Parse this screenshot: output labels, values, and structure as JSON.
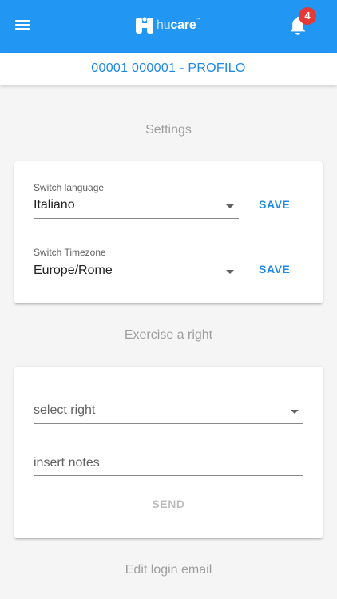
{
  "appbar": {
    "menu_icon": "hamburger-menu-icon",
    "logo": {
      "hu": "hu",
      "care": "care",
      "tm": "™"
    },
    "notifications": {
      "icon": "bell-icon",
      "count": "4"
    },
    "colors": {
      "primary": "#2196f3",
      "badge": "#e53935"
    }
  },
  "subheader": {
    "title": "00001 000001 - PROFILO"
  },
  "sections": {
    "settings": "Settings",
    "exercise": "Exercise a right",
    "login_email": "Edit login email"
  },
  "settings_card": {
    "language": {
      "label": "Switch language",
      "value": "Italiano",
      "save": "SAVE"
    },
    "timezone": {
      "label": "Switch Timezone",
      "value": "Europe/Rome",
      "save": "SAVE"
    }
  },
  "exercise_card": {
    "select_right": {
      "placeholder": "select right"
    },
    "notes": {
      "placeholder": "insert notes",
      "value": ""
    },
    "send": "SEND"
  }
}
